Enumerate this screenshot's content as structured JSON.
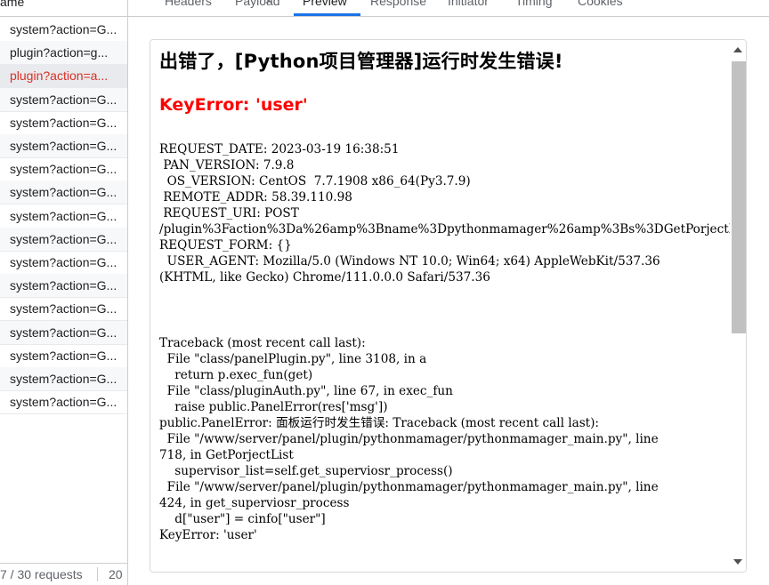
{
  "left_panel": {
    "header": "ame",
    "rows": [
      {
        "name": "system?action=G...",
        "state": "normal"
      },
      {
        "name": "plugin?action=g...",
        "state": "normal"
      },
      {
        "name": "plugin?action=a...",
        "state": "error"
      },
      {
        "name": "system?action=G...",
        "state": "normal"
      },
      {
        "name": "system?action=G...",
        "state": "normal"
      },
      {
        "name": "system?action=G...",
        "state": "normal"
      },
      {
        "name": "system?action=G...",
        "state": "normal"
      },
      {
        "name": "system?action=G...",
        "state": "normal"
      },
      {
        "name": "system?action=G...",
        "state": "normal"
      },
      {
        "name": "system?action=G...",
        "state": "normal"
      },
      {
        "name": "system?action=G...",
        "state": "normal"
      },
      {
        "name": "system?action=G...",
        "state": "normal"
      },
      {
        "name": "system?action=G...",
        "state": "normal"
      },
      {
        "name": "system?action=G...",
        "state": "normal"
      },
      {
        "name": "system?action=G...",
        "state": "normal"
      },
      {
        "name": "system?action=G...",
        "state": "normal"
      },
      {
        "name": "system?action=G...",
        "state": "normal"
      }
    ],
    "footer": {
      "count": "7 / 30 requests",
      "size": "20"
    }
  },
  "tabs": [
    {
      "label": "Headers",
      "active": false
    },
    {
      "label": "Payload",
      "active": false
    },
    {
      "label": "Preview",
      "active": true
    },
    {
      "label": "Response",
      "active": false
    },
    {
      "label": "Initiator",
      "active": false
    },
    {
      "label": "Timing",
      "active": false
    },
    {
      "label": "Cookies",
      "active": false
    }
  ],
  "preview": {
    "title": "出错了，[Python项目管理器]运行时发生错误!",
    "error": "KeyError: 'user'",
    "request_info": "REQUEST_DATE: 2023-03-19 16:38:51\n PAN_VERSION: 7.9.8\n  OS_VERSION: CentOS  7.7.1908 x86_64(Py3.7.9)\n REMOTE_ADDR: 58.39.110.98\n REQUEST_URI: POST\n/plugin%3Faction%3Da%26amp%3Bname%3Dpythonmamager%26amp%3Bs%3DGetPorjectList\nREQUEST_FORM: {}\n  USER_AGENT: Mozilla/5.0 (Windows NT 10.0; Win64; x64) AppleWebKit/537.36\n(KHTML, like Gecko) Chrome/111.0.0.0 Safari/537.36",
    "traceback": "Traceback (most recent call last):\n  File \"class/panelPlugin.py\", line 3108, in a\n    return p.exec_fun(get)\n  File \"class/pluginAuth.py\", line 67, in exec_fun\n    raise public.PanelError(res['msg'])\npublic.PanelError: 面板运行时发生错误: Traceback (most recent call last):\n  File \"/www/server/panel/plugin/pythonmamager/pythonmamager_main.py\", line\n718, in GetPorjectList\n    supervisor_list=self.get_superviosr_process()\n  File \"/www/server/panel/plugin/pythonmamager/pythonmamager_main.py\", line\n424, in get_superviosr_process\n    d[\"user\"] = cinfo[\"user\"]\nKeyError: 'user'"
  },
  "colors": {
    "accent": "#1a73e8",
    "error_text": "#ff0000",
    "error_row": "#d93025"
  }
}
